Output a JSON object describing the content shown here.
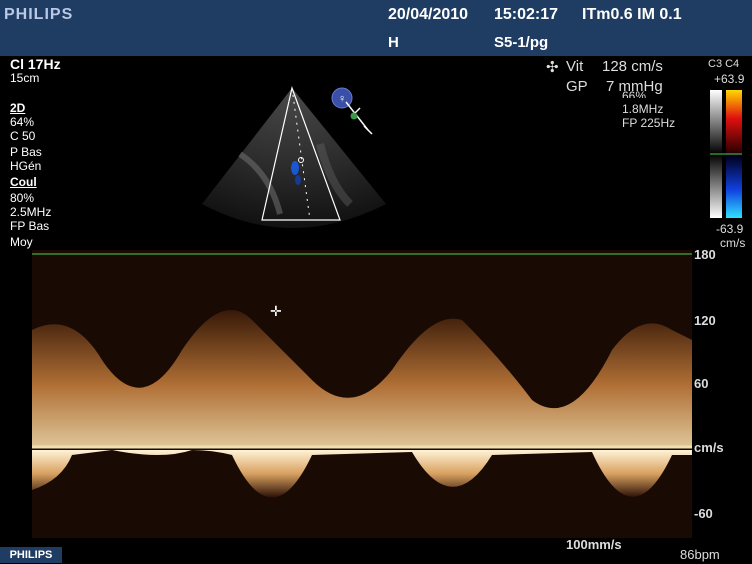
{
  "header": {
    "brand": "PHILIPS",
    "date": "20/04/2010",
    "time": "15:02:17",
    "tis_mi": "ITm0.6  IM 0.1",
    "mode_marker": "H",
    "probe": "S5-1/pg"
  },
  "left_params": {
    "line1": "Cl 17Hz",
    "line2": "15cm",
    "sec_2d": "2D",
    "gain2d": " 64%",
    "c": "C 50",
    "p": "P Bas",
    "hgen": "HGén",
    "sec_coul": "Coul",
    "gaincoul": " 80%",
    "freq": "2.5MHz",
    "fp": "FP Bas",
    "moy": "Moy"
  },
  "readouts": {
    "vit_label": "Vit",
    "vit_value": "128 cm/s",
    "gp_label": "GP",
    "gp_value": "7 mmHg"
  },
  "doppler_params": {
    "partial": "66%",
    "freq": "1.8MHz",
    "fp": "FP 225Hz"
  },
  "colorbar": {
    "label": "C3 C4",
    "max": "+63.9",
    "min": "-63.9",
    "unit": "cm/s"
  },
  "axis": {
    "ticks": [
      "180",
      "120",
      "60",
      "cm/s",
      "-60"
    ]
  },
  "footer": {
    "brand": "PHILIPS",
    "sweep": "100mm/s",
    "hr": "86bpm"
  },
  "colors": {
    "header_bg": "#1f3c62",
    "ecg": "#4ccd4c",
    "spectrum": "#e0a86a"
  }
}
